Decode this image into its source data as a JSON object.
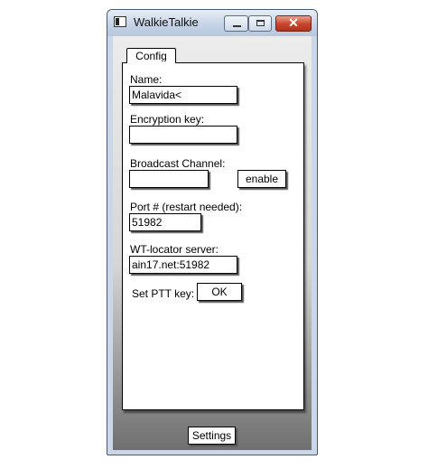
{
  "window": {
    "title": "WalkieTalkie",
    "close_glyph": "✕"
  },
  "tabs": [
    {
      "label": "Config"
    }
  ],
  "config": {
    "name_label": "Name:",
    "name_value": "Malavida<",
    "encryption_label": "Encryption key:",
    "encryption_value": "",
    "broadcast_label": "Broadcast Channel:",
    "broadcast_value": "",
    "enable_label": "enable",
    "port_label": "Port # (restart needed):",
    "port_value": "51982",
    "locator_label": "WT-locator server:",
    "locator_value": "ain17.net:51982",
    "ptt_label": "Set PTT key:",
    "ok_label": "OK"
  },
  "footer": {
    "settings_label": "Settings"
  }
}
